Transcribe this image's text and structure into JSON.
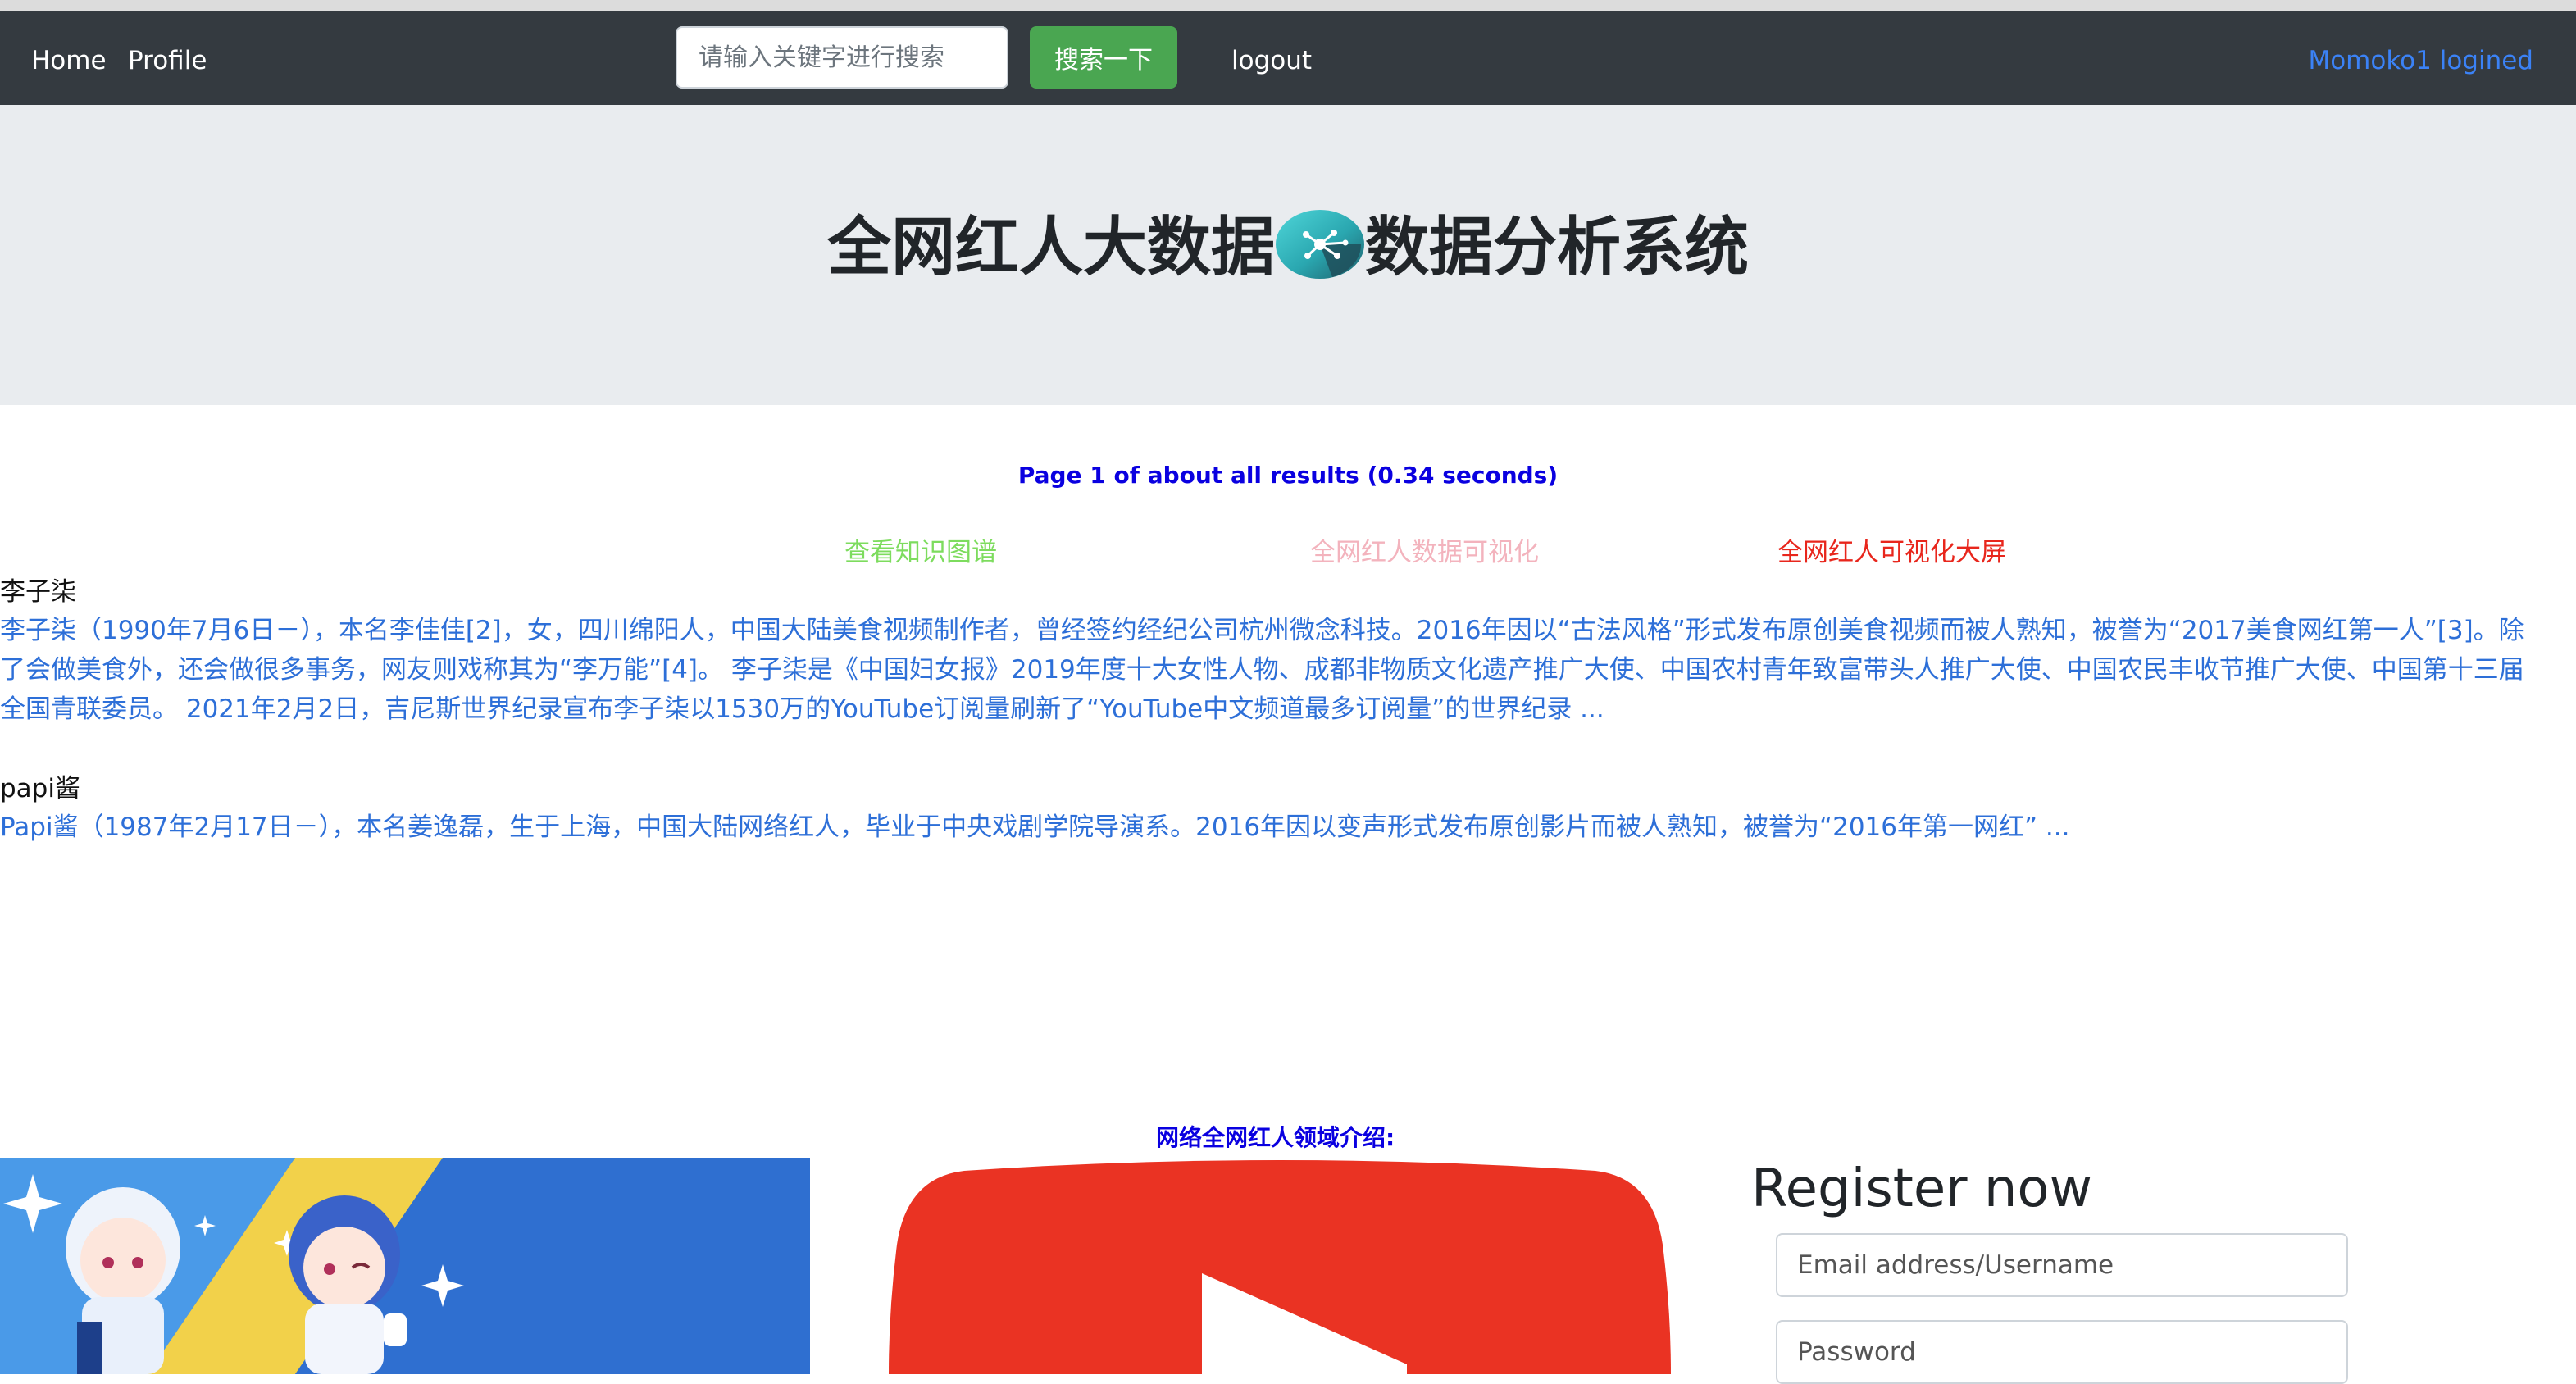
{
  "navbar": {
    "home_label": "Home",
    "profile_label": "Profile",
    "search_placeholder": "请输入关键字进行搜索",
    "search_button_label": "搜索一下",
    "logout_label": "logout",
    "user_label": "Momoko1 logined"
  },
  "hero": {
    "title_left": "全网红人大数据",
    "title_right": "数据分析系统",
    "icon": "network-graph-icon"
  },
  "results_stats": "Page 1 of about all results (0.34 seconds)",
  "links": {
    "knowledge_graph": "查看知识图谱",
    "visualization": "全网红人数据可视化",
    "big_screen": "全网红人可视化大屏"
  },
  "results": [
    {
      "title": "李子柒",
      "snippet_lines": [
        "李子柒（1990年7月6日－），本名李佳佳[2]，女，四川绵阳人，中国大陆美食视频制作者，曾经签约经纪公司杭州微念科技。2016年因以“古法风格”形式发布原创美食视频而被人熟知，被誉为“2017美食网红第一人”[3]。除",
        "了会做美食外，还会做很多事务，网友则戏称其为“李万能”[4]。 李子柒是《中国妇女报》2019年度十大女性人物、成都非物质文化遗产推广大使、中国农村青年致富带头人推广大使、中国农民丰收节推广大使、中国第十三届",
        "全国青联委员。 2021年2月2日，吉尼斯世界纪录宣布李子柒以1530万的YouTube订阅量刷新了“YouTube中文频道最多订阅量”的世界纪录 ..."
      ]
    },
    {
      "title": "papi酱",
      "snippet_lines": [
        "Papi酱（1987年2月17日－），本名姜逸磊，生于上海，中国大陆网络红人，毕业于中央戏剧学院导演系。2016年因以变声形式发布原创影片而被人熟知，被誉为“2016年第一网红” ..."
      ]
    }
  ],
  "video_section": {
    "caption": "网络全网红人领域介绍:",
    "icon": "youtube-play-icon"
  },
  "register": {
    "title": "Register now",
    "email_placeholder": "Email address/Username",
    "password_placeholder": "Password"
  },
  "colors": {
    "navbar_bg": "#343a40",
    "hero_bg": "#e9ecef",
    "search_button": "#4aa651",
    "user_link": "#3b82f6",
    "stats_text": "#0a00e0",
    "link_knowledge_graph": "#7ddc5e",
    "link_visualization": "#f3b3bd",
    "link_big_screen": "#e8261c",
    "snippet_text": "#2d6fd8",
    "youtube_red": "#ea3323"
  }
}
